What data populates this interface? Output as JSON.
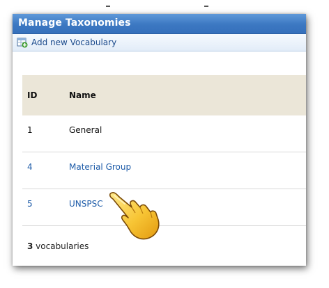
{
  "window": {
    "title": "Manage Taxonomies"
  },
  "toolbar": {
    "add_label": "Add new Vocabulary",
    "add_icon": "add-table-icon"
  },
  "table": {
    "columns": [
      "ID",
      "Name"
    ],
    "rows": [
      {
        "id": "1",
        "name": "General",
        "link": false
      },
      {
        "id": "4",
        "name": "Material Group",
        "link": true
      },
      {
        "id": "5",
        "name": "UNSPSC",
        "link": true
      }
    ]
  },
  "footer": {
    "count": "3",
    "suffix": " vocabularies"
  },
  "pointer": {
    "icon": "pointing-hand-icon"
  },
  "colors": {
    "titlebar": "#3c78c2",
    "link": "#1d5ba8",
    "header_bg": "#ebe6d8"
  }
}
